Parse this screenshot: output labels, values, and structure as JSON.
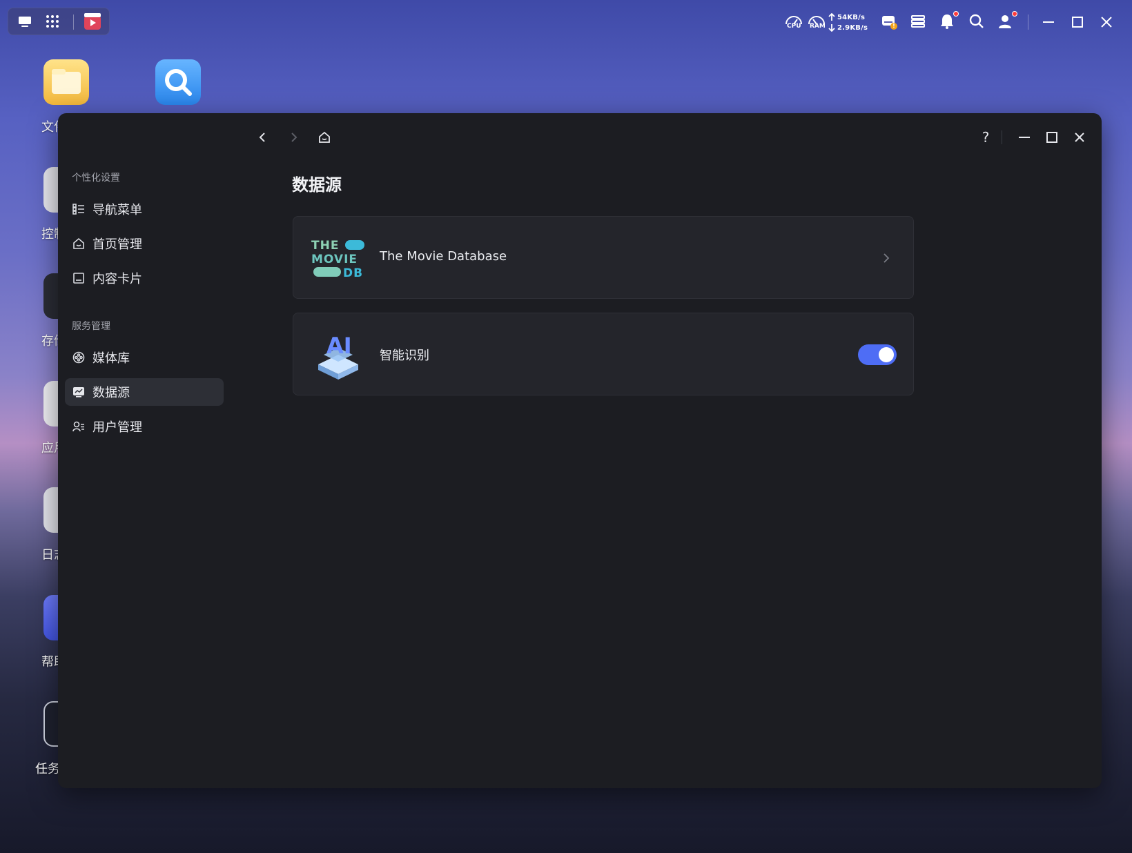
{
  "taskbar": {
    "cpu_label": "CPU",
    "ram_label": "RAM",
    "upload_speed": "54KB/s",
    "download_speed": "2.9KB/s",
    "icons": [
      "desktop-icon",
      "app-grid-icon",
      "video-player-icon",
      "cpu-gauge-icon",
      "ram-gauge-icon",
      "storage-alert-icon",
      "control-panel-icon",
      "notification-bell-icon",
      "search-icon",
      "user-icon",
      "minimize-icon",
      "maximize-icon",
      "close-icon"
    ],
    "storage_badge": "!"
  },
  "desktop": {
    "labels": [
      "文件",
      "控制",
      "存储",
      "应用",
      "日志",
      "帮助",
      "任务"
    ]
  },
  "window": {
    "sidebar": {
      "sections": [
        {
          "title": "个性化设置",
          "items": [
            {
              "label": "导航菜单",
              "icon": "list-icon"
            },
            {
              "label": "首页管理",
              "icon": "home-icon"
            },
            {
              "label": "内容卡片",
              "icon": "card-icon"
            }
          ]
        },
        {
          "title": "服务管理",
          "items": [
            {
              "label": "媒体库",
              "icon": "media-library-icon"
            },
            {
              "label": "数据源",
              "icon": "data-source-icon",
              "active": true
            },
            {
              "label": "用户管理",
              "icon": "users-icon"
            }
          ]
        }
      ]
    },
    "help_label": "?",
    "page_title": "数据源",
    "cards": [
      {
        "label": "The Movie Database",
        "logo_lines": [
          "THE",
          "MOVIE",
          "DB"
        ],
        "action": "chevron-right-icon"
      },
      {
        "label": "智能识别",
        "logo_text": "AI",
        "toggle_on": true
      }
    ]
  },
  "colors": {
    "window_bg": "#1c1d22",
    "card_bg": "#24252b",
    "accent": "#4e6df5",
    "tmdb_teal": "#8ed1b4",
    "tmdb_blue": "#3cbad9"
  }
}
